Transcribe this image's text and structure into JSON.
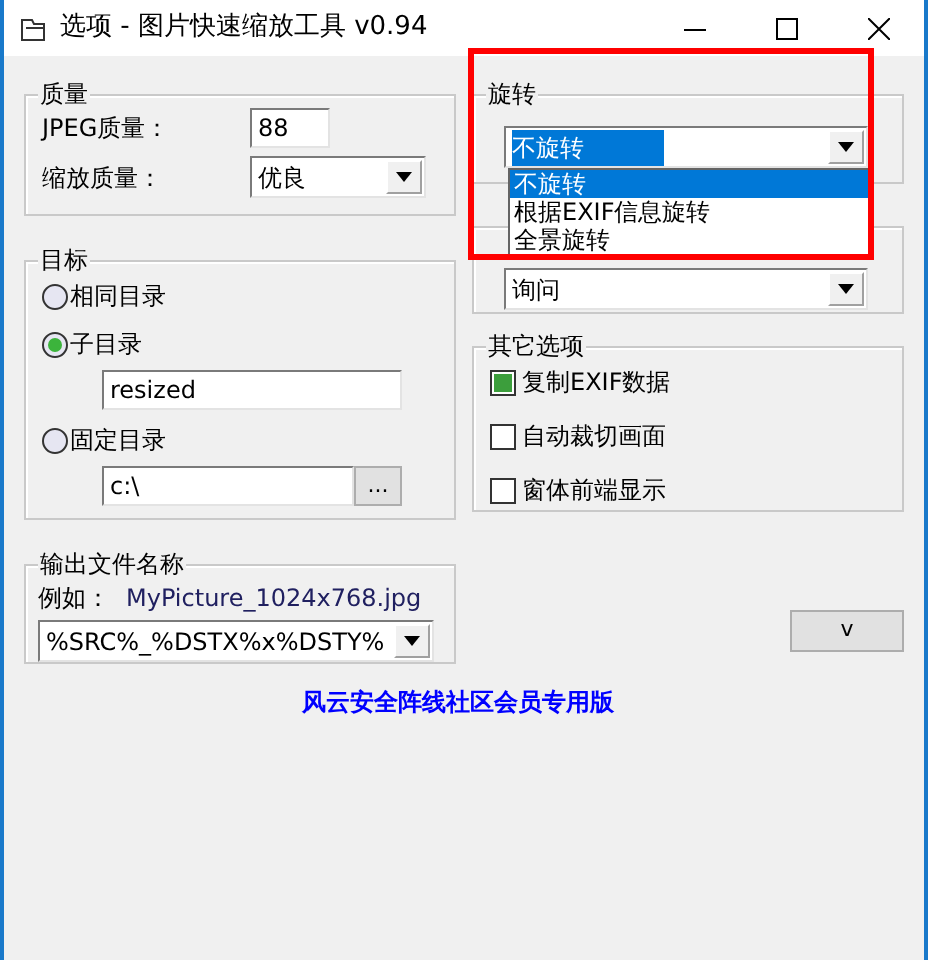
{
  "window": {
    "title": "选项 - 图片快速缩放工具 v0.94"
  },
  "quality": {
    "title": "质量",
    "jpeg_label": "JPEG质量：",
    "jpeg_value": "88",
    "scale_label": "缩放质量：",
    "scale_value": "优良"
  },
  "target": {
    "title": "目标",
    "options": [
      {
        "label": "相同目录",
        "selected": false
      },
      {
        "label": "子目录",
        "selected": true,
        "value": "resized"
      },
      {
        "label": "固定目录",
        "selected": false,
        "value": "c:\\",
        "button": "..."
      }
    ]
  },
  "output": {
    "title": "输出文件名称",
    "example_label": "例如：",
    "example": "MyPicture_1024x768.jpg",
    "pattern": "%SRC%_%DSTX%x%DSTY%"
  },
  "rotation": {
    "title": "旋转",
    "value": "不旋转",
    "expanded": true,
    "options": [
      {
        "label": "不旋转",
        "selected": true
      },
      {
        "label": "根据EXIF信息旋转",
        "selected": false
      },
      {
        "label": "全景旋转",
        "selected": false
      }
    ]
  },
  "crop": {
    "value": "询问"
  },
  "other": {
    "title": "其它选项",
    "options": [
      {
        "label": "复制EXIF数据",
        "checked": true
      },
      {
        "label": "自动裁切画面",
        "checked": false
      },
      {
        "label": "窗体前端显示",
        "checked": false
      }
    ]
  },
  "expand_button": "v",
  "footer": "风云安全阵线社区会员专用版",
  "highlight": true
}
